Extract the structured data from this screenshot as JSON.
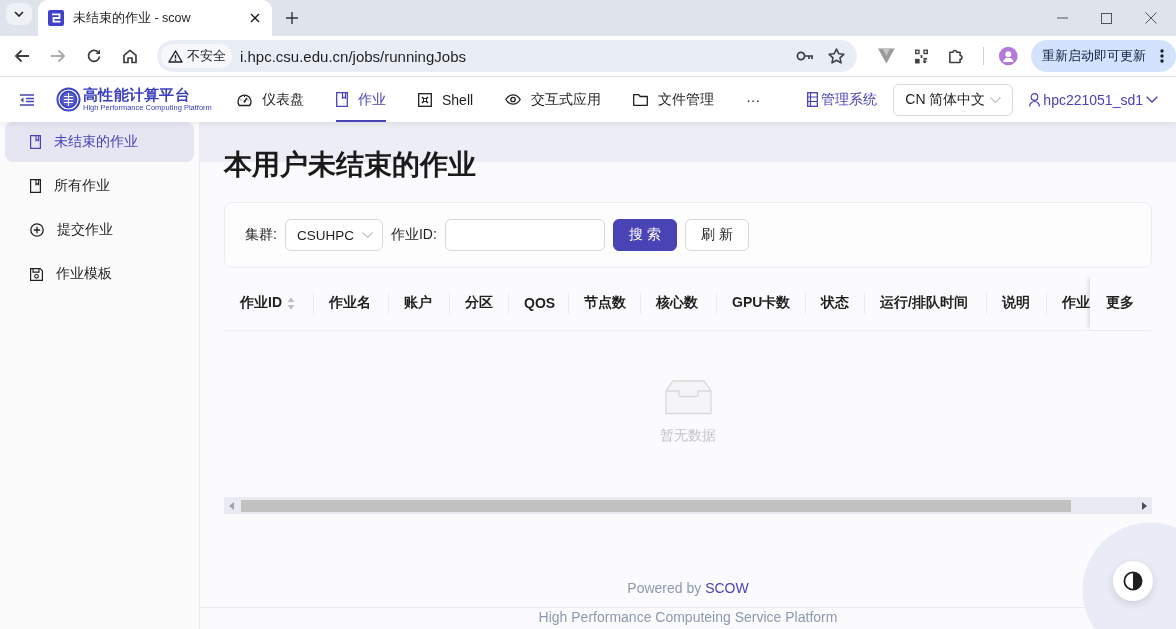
{
  "browser": {
    "tabs": [
      {
        "title": "未结束的作业 - scow",
        "selected": true
      }
    ],
    "toolbar": {
      "back_disabled": false,
      "forward_disabled": true
    },
    "security_label": "不安全",
    "url": "i.hpc.csu.edu.cn/jobs/runningJobs",
    "update_button": "重新启动即可更新"
  },
  "header": {
    "logo": {
      "title": "高性能计算平台",
      "subtitle": "High Performance Computing Platform"
    },
    "nav": [
      {
        "label": "仪表盘",
        "selected": false
      },
      {
        "label": "作业",
        "selected": true
      },
      {
        "label": "Shell",
        "selected": false
      },
      {
        "label": "交互式应用",
        "selected": false
      },
      {
        "label": "文件管理",
        "selected": false
      }
    ],
    "more": "···",
    "admin_link": "管理系统",
    "language": "CN 简体中文",
    "user": "hpc221051_sd1"
  },
  "sidebar": {
    "items": [
      {
        "label": "未结束的作业",
        "selected": true
      },
      {
        "label": "所有作业",
        "selected": false
      },
      {
        "label": "提交作业",
        "selected": false
      },
      {
        "label": "作业模板",
        "selected": false
      }
    ]
  },
  "page": {
    "title": "本用户未结束的作业"
  },
  "filter": {
    "cluster_label": "集群:",
    "cluster_value": "CSUHPC",
    "job_id_label": "作业ID:",
    "search_button": "搜 索",
    "refresh_button": "刷 新"
  },
  "table": {
    "columns": [
      {
        "label": "作业ID",
        "sortable": true
      },
      {
        "label": "作业名",
        "sortable": false
      },
      {
        "label": "账户",
        "sortable": false
      },
      {
        "label": "分区",
        "sortable": false
      },
      {
        "label": "QOS",
        "sortable": false
      },
      {
        "label": "节点数",
        "sortable": false
      },
      {
        "label": "核心数",
        "sortable": false
      },
      {
        "label": "GPU卡数",
        "sortable": false
      },
      {
        "label": "状态",
        "sortable": false
      },
      {
        "label": "运行/排队时间",
        "sortable": false
      },
      {
        "label": "说明",
        "sortable": false
      },
      {
        "label": "作业",
        "sortable": false
      }
    ],
    "fixed_column": "更多",
    "empty_text": "暂无数据"
  },
  "footer": {
    "powered_by": "Powered by",
    "link": "SCOW",
    "platform": "High Performance Computeing Service Platform"
  }
}
